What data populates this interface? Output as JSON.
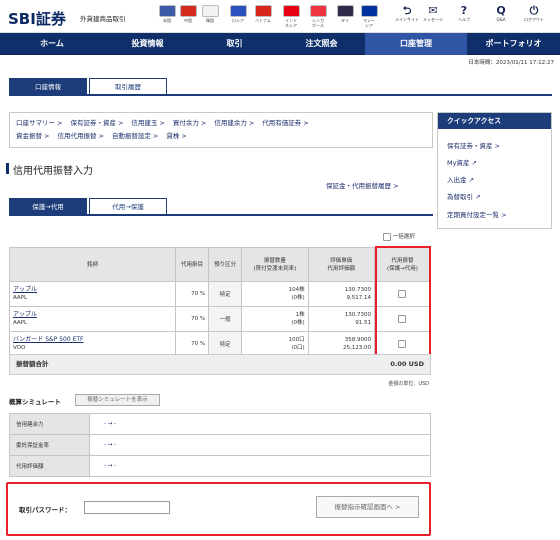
{
  "header": {
    "logo": "SBI証券",
    "logo_sub": "外貨建商品取引",
    "flags": [
      {
        "label": "米国",
        "color": "#3b5ba9",
        "icon": "us-flag-icon"
      },
      {
        "label": "中国",
        "color": "#d52b1e",
        "icon": "cn-flag-icon"
      },
      {
        "label": "韓国",
        "color": "#f3f3f3",
        "icon": "kr-flag-icon"
      },
      {
        "label": "ロシア",
        "color": "#2a52be",
        "icon": "ru-flag-icon"
      },
      {
        "label": "ベトナム",
        "color": "#da251d",
        "icon": "vn-flag-icon"
      },
      {
        "label": "インド\nネシア",
        "color": "#e70011",
        "icon": "id-flag-icon"
      },
      {
        "label": "シンガ\nポール",
        "color": "#ef3340",
        "icon": "sg-flag-icon"
      },
      {
        "label": "タイ",
        "color": "#2d2a4a",
        "icon": "th-flag-icon"
      },
      {
        "label": "マレー\nシア",
        "color": "#0032a0",
        "icon": "my-flag-icon"
      }
    ],
    "utility": [
      {
        "label": "メインサイト",
        "glyph": "⮌"
      },
      {
        "label": "メッセージ",
        "glyph": "✉"
      },
      {
        "label": "ヘルプ",
        "glyph": "?"
      },
      {
        "label": "Q&A",
        "glyph": "Q"
      },
      {
        "label": "ログアウト",
        "glyph": "⏻"
      }
    ]
  },
  "nav": {
    "items": [
      "ホーム",
      "投資情報",
      "取引",
      "注文照会",
      "口座管理",
      "ポートフォリオ"
    ],
    "active_index": 4
  },
  "timestamp": "日本時間：2023/01/11 17:12:27",
  "top_tabs": [
    "口座情報",
    "取引履歴"
  ],
  "breadcrumbs": {
    "row1": [
      "口座サマリー",
      "保有証券・資産",
      "信用建玉",
      "買付余力",
      "信用建余力",
      "代用有価証券"
    ],
    "row2": [
      "資金振替",
      "信用代用振替",
      "自動振替設定",
      "貸株"
    ]
  },
  "quick_access": {
    "title": "クイックアクセス",
    "items": [
      "保有証券・資産 >",
      "My資産 ↗",
      "入出金 ↗",
      "為替取引 ↗",
      "定期買付設定一覧 >"
    ]
  },
  "page_title": "信用代用振替入力",
  "history_link": "保証金・代用振替履歴 >",
  "sub_tabs": [
    "保護→代用",
    "代用→保護"
  ],
  "select_all": "一括選択",
  "table": {
    "headers": [
      "銘柄",
      "代用掛目",
      "預り区分",
      "振替数量\n(買付受渡未到来)",
      "評価単価\n代用評価額",
      "代用振替\n(保護→代用)"
    ],
    "rows": [
      {
        "name": "アップル",
        "ticker": "AAPL",
        "ratio": "70 %",
        "kubun": "特定",
        "qty": "104株",
        "qty_sub": "(0株)",
        "price": "130.7300",
        "value": "9,517.14"
      },
      {
        "name": "アップル",
        "ticker": "AAPL",
        "ratio": "70 %",
        "kubun": "一般",
        "qty": "1株",
        "qty_sub": "(0株)",
        "price": "130.7300",
        "value": "91.51"
      },
      {
        "name": "バンガード S&P 500 ETF",
        "ticker": "VOO",
        "ratio": "70 %",
        "kubun": "特定",
        "qty": "100口",
        "qty_sub": "(0口)",
        "price": "358.9000",
        "value": "25,123.00"
      }
    ],
    "total_label": "振替額合計",
    "total_value": "0.00 USD",
    "unit_note": "金額の単位：USD"
  },
  "simulation": {
    "title": "概算シミュレート",
    "button": "振替シミュレートを表示",
    "rows": [
      {
        "label": "信用建余力",
        "value": "- → -"
      },
      {
        "label": "委託保証金率",
        "value": "- → -"
      },
      {
        "label": "代用評価額",
        "value": "- → -"
      }
    ]
  },
  "password": {
    "label": "取引パスワード：",
    "value": "",
    "confirm_button": "振替指示確認画面へ >"
  }
}
